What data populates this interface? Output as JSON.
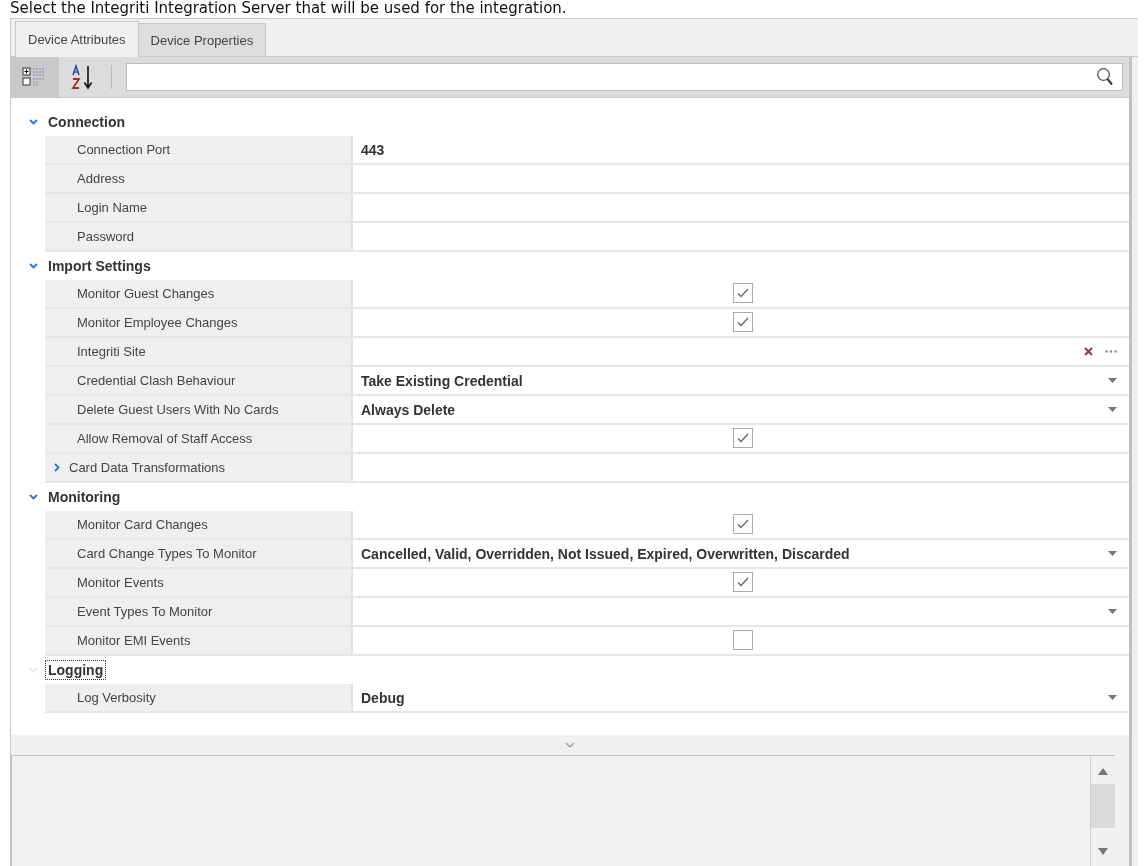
{
  "instruction": "Select the Integriti Integration Server that will be used for the integration.",
  "tabs": [
    {
      "label": "Device Attributes",
      "selected": true
    },
    {
      "label": "Device Properties",
      "selected": false
    }
  ],
  "toolbar": {
    "categorized_selected": true,
    "alphabetical_selected": false
  },
  "categories": [
    {
      "name": "Connection",
      "expanded": true,
      "focused": false,
      "rows": [
        {
          "label": "Connection Port",
          "kind": "text",
          "value": "443"
        },
        {
          "label": "Address",
          "kind": "text"
        },
        {
          "label": "Login Name",
          "kind": "text"
        },
        {
          "label": "Password",
          "kind": "text"
        }
      ]
    },
    {
      "name": "Import Settings",
      "expanded": true,
      "focused": false,
      "rows": [
        {
          "label": "Monitor Guest Changes",
          "kind": "check",
          "checked": true
        },
        {
          "label": "Monitor Employee Changes",
          "kind": "check",
          "checked": true
        },
        {
          "label": "Integriti Site",
          "kind": "picker"
        },
        {
          "label": "Credential Clash Behaviour",
          "kind": "dropdown",
          "value": "Take Existing Credential"
        },
        {
          "label": "Delete Guest Users With No Cards",
          "kind": "dropdown",
          "value": "Always Delete"
        },
        {
          "label": "Allow Removal of Staff Access",
          "kind": "check",
          "checked": true
        },
        {
          "label": "Card Data Transformations",
          "kind": "group",
          "expanded": false
        }
      ]
    },
    {
      "name": "Monitoring",
      "expanded": true,
      "focused": false,
      "rows": [
        {
          "label": "Monitor Card Changes",
          "kind": "check",
          "checked": true
        },
        {
          "label": "Card Change Types To Monitor",
          "kind": "dropdown",
          "value": "Cancelled, Valid, Overridden, Not Issued, Expired, Overwritten, Discarded"
        },
        {
          "label": "Monitor Events",
          "kind": "check",
          "checked": true
        },
        {
          "label": "Event Types To Monitor",
          "kind": "dropdown"
        },
        {
          "label": "Monitor EMI Events",
          "kind": "check",
          "checked": false
        }
      ]
    },
    {
      "name": "Logging",
      "expanded": true,
      "focused": true,
      "rows": [
        {
          "label": "Log Verbosity",
          "kind": "dropdown",
          "value": "Debug"
        }
      ]
    }
  ]
}
